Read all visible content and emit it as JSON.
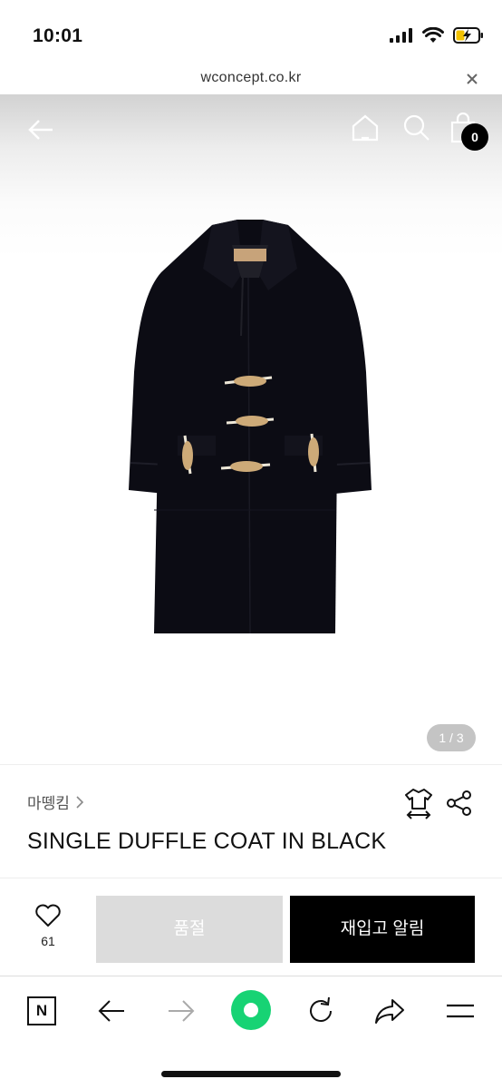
{
  "status_bar": {
    "time": "10:01"
  },
  "url_bar": {
    "url": "wconcept.co.kr"
  },
  "product_nav": {
    "bag_count": "0"
  },
  "gallery": {
    "pager": "1 / 3"
  },
  "product": {
    "brand": "마뗑킴",
    "name": "SINGLE DUFFLE COAT IN BLACK"
  },
  "actions": {
    "like_count": "61",
    "soldout_label": "품절",
    "restock_label": "재입고 알림"
  },
  "toolbar": {
    "naver_label": "N"
  },
  "colors": {
    "accent_green": "#17d374",
    "coat": "#0c0c14"
  }
}
